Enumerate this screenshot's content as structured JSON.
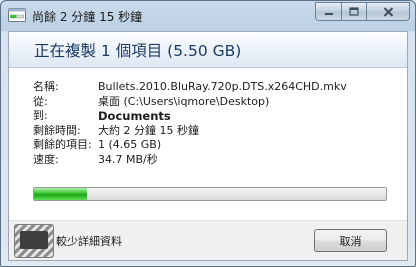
{
  "window": {
    "title": "尚餘 2 分鐘 15 秒鐘"
  },
  "header": {
    "title": "正在複製 1 個項目 (5.50 GB)"
  },
  "details": {
    "rows": [
      {
        "label": "名稱:",
        "value": "Bullets.2010.BluRay.720p.DTS.x264CHD.mkv",
        "bold": false
      },
      {
        "label": "從:",
        "value": "桌面 (C:\\Users\\iqmore\\Desktop)",
        "bold": false
      },
      {
        "label": "到:",
        "value": "Documents",
        "bold": true
      },
      {
        "label": "剩餘時間:",
        "value": "大約 2 分鐘 15 秒鐘",
        "bold": false
      },
      {
        "label": "剩餘的項目:",
        "value": "1 (4.65 GB)",
        "bold": false
      },
      {
        "label": "速度:",
        "value": "34.7 MB/秒",
        "bold": false
      }
    ]
  },
  "progress": {
    "fraction": 0.15,
    "color": "#2fbf27"
  },
  "footer": {
    "less_details_label": "較少詳細資料",
    "cancel_label": "取消"
  },
  "icons": {
    "title": "copy-progress-icon",
    "minimize": "minimize-icon",
    "maximize": "maximize-icon",
    "close": "close-icon",
    "details_toggle": "chevron-up-icon"
  }
}
